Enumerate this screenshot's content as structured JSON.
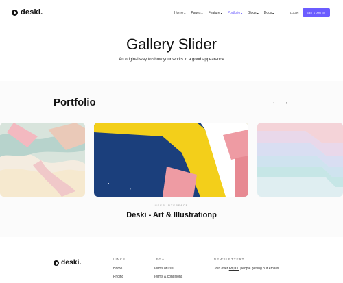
{
  "header": {
    "brand": "deski.",
    "nav": [
      {
        "label": "Home"
      },
      {
        "label": "Pages"
      },
      {
        "label": "Feature"
      },
      {
        "label": "Portfolio"
      },
      {
        "label": "Blogs"
      },
      {
        "label": "Docs"
      }
    ],
    "login": "LOGIN",
    "cta": "GET STARTED"
  },
  "hero": {
    "title": "Gallery Slider",
    "subtitle": "An original way to show your works in a good appearance"
  },
  "portfolio": {
    "title": "Portfolio",
    "prev_arrow": "←",
    "next_arrow": "→",
    "caption_sub": "USER INTERFACE",
    "caption_title": "Deski - Art & Illustrationp"
  },
  "footer": {
    "brand": "deski.",
    "links_heading": "LINKS",
    "links": [
      "Home",
      "Pricing"
    ],
    "legal_heading": "LEGAL",
    "legal": [
      "Terms of use",
      "Terms & conditions"
    ],
    "newsletter_heading": "NEWSLETTERT",
    "newsletter_before": "Join over ",
    "newsletter_count": "68,000",
    "newsletter_after": " people getting our emails"
  },
  "colors": {
    "accent": "#6b5cff",
    "slide_navy": "#1b3f7c",
    "slide_yellow": "#f3cf1a",
    "slide_pink": "#ee9ba3"
  }
}
